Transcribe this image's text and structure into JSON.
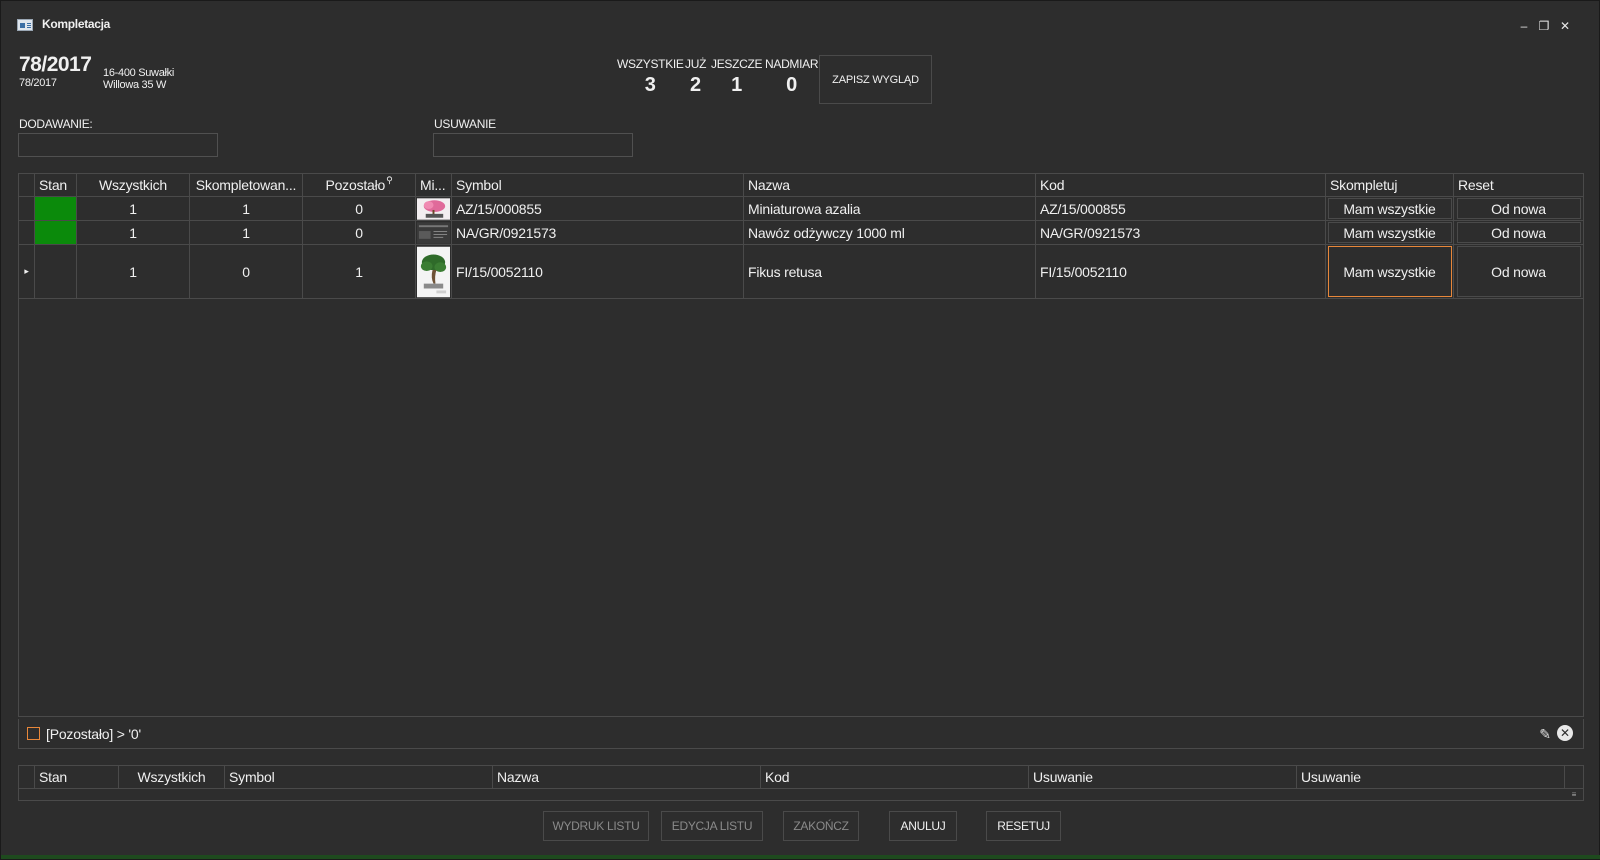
{
  "window": {
    "title": "Kompletacja",
    "minimize": "‒",
    "restore": "❐",
    "close": "✕"
  },
  "header": {
    "doc_number": "78/2017",
    "doc_sub": "78/2017",
    "address_line1": "16-400 Suwałki",
    "address_line2": "Willowa 35 W",
    "stats": [
      {
        "label": "WSZYSTKIE",
        "value": "3"
      },
      {
        "label": "JUŻ",
        "value": "2"
      },
      {
        "label": "JESZCZE",
        "value": "1"
      },
      {
        "label": "NADMIAR",
        "value": "0"
      }
    ],
    "save_layout_label": "ZAPISZ WYGLĄD"
  },
  "fields": {
    "adding_label": "DODAWANIE:",
    "adding_value": "",
    "removing_label": "USUWANIE",
    "removing_value": ""
  },
  "grid": {
    "columns": [
      "Stan",
      "Wszystkich",
      "Skompletowan...",
      "Pozostało",
      "Mi...",
      "Symbol",
      "Nazwa",
      "Kod",
      "Skompletuj",
      "Reset"
    ],
    "filter_icon": "filter-icon",
    "rows": [
      {
        "stan_color": "#0b8a0b",
        "wszystkich": "1",
        "skompletowane": "1",
        "pozostalo": "0",
        "symbol": "AZ/15/000855",
        "nazwa": "Miniaturowa azalia",
        "kod": "AZ/15/000855",
        "btn_complete": "Mam wszystkie",
        "btn_reset": "Od nowa",
        "thumb": "azalea-thumbnail"
      },
      {
        "stan_color": "#0b8a0b",
        "wszystkich": "1",
        "skompletowane": "1",
        "pozostalo": "0",
        "symbol": "NA/GR/0921573",
        "nazwa": "Nawóz odżywczy 1000 ml",
        "kod": "NA/GR/0921573",
        "btn_complete": "Mam wszystkie",
        "btn_reset": "Od nowa",
        "thumb": "fertilizer-thumbnail"
      },
      {
        "stan_color": "",
        "wszystkich": "1",
        "skompletowane": "0",
        "pozostalo": "1",
        "symbol": "FI/15/0052110",
        "nazwa": "Fikus retusa",
        "kod": "FI/15/0052110",
        "btn_complete": "Mam wszystkie",
        "btn_reset": "Od nowa",
        "thumb": "bonsai-thumbnail"
      }
    ],
    "row_pointer": "▸"
  },
  "filter": {
    "text": "[Pozostało] > '0'",
    "edit_icon": "✎",
    "clear_icon": "✕"
  },
  "grid2": {
    "columns": [
      "Stan",
      "Wszystkich",
      "Symbol",
      "Nazwa",
      "Kod",
      "Usuwanie",
      "Usuwanie"
    ]
  },
  "buttons": {
    "print": "WYDRUK LISTU",
    "edit": "EDYCJA LISTU",
    "finish": "ZAKOŃCZ",
    "cancel": "ANULUJ",
    "reset": "RESETUJ"
  }
}
